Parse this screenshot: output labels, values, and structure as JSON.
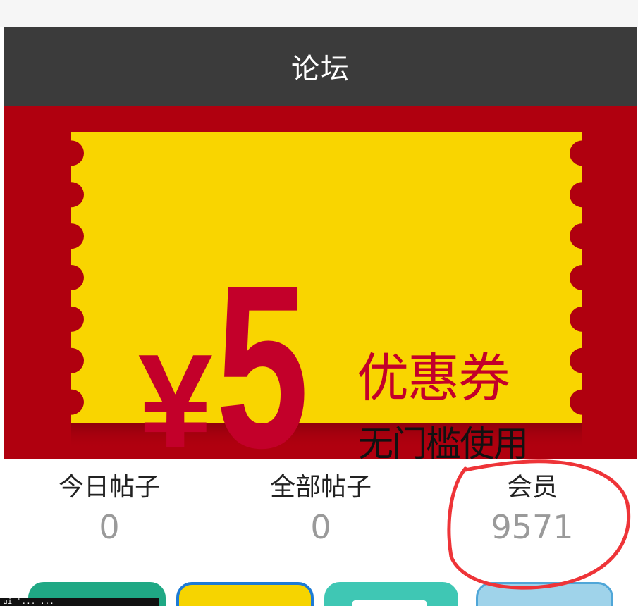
{
  "header": {
    "title": "论坛"
  },
  "banner": {
    "currency_symbol": "¥",
    "amount": "5",
    "title": "优惠券",
    "subtitle": "无门槛使用",
    "colors": {
      "background": "#b0000f",
      "coupon": "#f9d500",
      "text": "#c3002a"
    }
  },
  "stats": [
    {
      "label": "今日帖子",
      "value": "0"
    },
    {
      "label": "全部帖子",
      "value": "0"
    },
    {
      "label": "会员",
      "value": "9571"
    }
  ],
  "tooltip": {
    "text": "ui \"... ..."
  }
}
